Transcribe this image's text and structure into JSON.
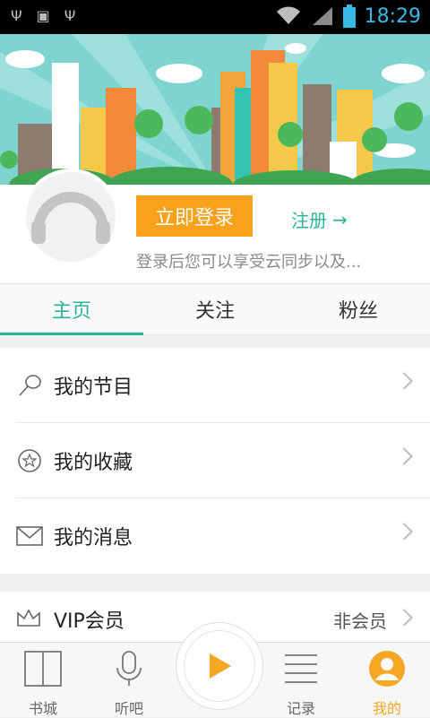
{
  "status_bar": {
    "time": "18:29"
  },
  "profile": {
    "login_label": "立即登录",
    "register_label": "注册",
    "hint": "登录后您可以享受云同步以及..."
  },
  "tabs": [
    {
      "label": "主页",
      "active": true
    },
    {
      "label": "关注",
      "active": false
    },
    {
      "label": "粉丝",
      "active": false
    }
  ],
  "menu": [
    {
      "label": "我的节目",
      "icon": "microphone-icon"
    },
    {
      "label": "我的收藏",
      "icon": "star-icon"
    },
    {
      "label": "我的消息",
      "icon": "envelope-icon"
    }
  ],
  "vip": {
    "label": "VIP会员",
    "value": "非会员",
    "icon": "crown-icon"
  },
  "bottom_nav": [
    {
      "label": "书城",
      "icon": "book-icon"
    },
    {
      "label": "听吧",
      "icon": "microphone-icon"
    },
    {
      "label": "记录",
      "icon": "list-icon"
    },
    {
      "label": "我的",
      "icon": "user-icon",
      "active": true
    }
  ],
  "colors": {
    "accent": "#2ab597",
    "orange": "#f8a11a",
    "active_nav": "#f5a623"
  }
}
